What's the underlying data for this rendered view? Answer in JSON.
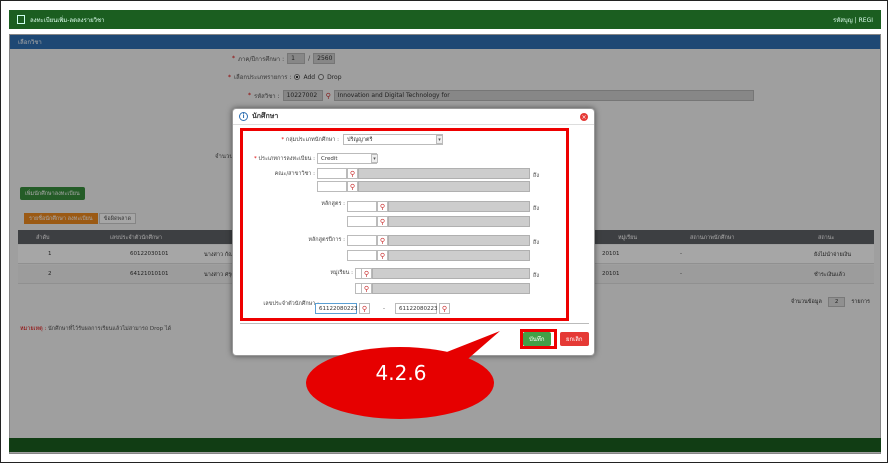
{
  "topbar": {
    "title": "ลงทะเบียนเพิ่ม-ลดลงรายวิชา",
    "user": "รหัสบุญ | REGI"
  },
  "section": {
    "title": "เลือกวิชา"
  },
  "form": {
    "term_label": "ภาค/ปีการศึกษา :",
    "term_value": "1",
    "year_value": "2560",
    "type_label": "เลือกประเภทรายการ :",
    "add_label": "Add",
    "drop_label": "Drop",
    "course_label": "รหัสวิชา :",
    "course_code": "10227002",
    "course_name": "Innovation and Digital Technology for",
    "other_label": "จำนวน"
  },
  "list_button": "เพิ่มนักศึกษาลงทะเบียน",
  "tabs": [
    "รายชื่อนักศึกษา ลงทะเบียน",
    "ข้อผิดพลาด"
  ],
  "table": {
    "headers": [
      "ลำดับ",
      "เลขประจำตัวนักศึกษา",
      "หมู่เรียน",
      "สถานภาพนักศึกษา",
      "สถานะ"
    ],
    "rows": [
      {
        "no": "1",
        "id": "60122030101",
        "name": "นางสาว กัณฑ์",
        "group": "20101",
        "status": "-",
        "state": "ยังไม่นำจ่ายเงิน"
      },
      {
        "no": "2",
        "id": "64121010101",
        "name": "นางสาว ศรุดา",
        "group": "20101",
        "status": "-",
        "state": "ชำระเงินแล้ว"
      }
    ]
  },
  "pager": {
    "label": "จำนวนข้อมูล",
    "count": "2",
    "unit": "รายการ"
  },
  "note": {
    "prefix": "หมายเหตุ :",
    "text": "นักศึกษาที่ไว้รับผลการเรียนแล้วไม่สามารถ Drop ได้"
  },
  "modal": {
    "title": "นักศึกษา",
    "student_type_label": "กลุ่มประเภทนักศึกษา :",
    "student_type_value": "ปริญญาตรี",
    "reg_type_label": "ประเภทการลงทะเบียน :",
    "reg_type_value": "Credit",
    "faculty_label": "คณะ/สาขาวิชา :",
    "curriculum_label": "หลักสูตร :",
    "curriculum_year_label": "หลักสูตรปีการ :",
    "group_label": "หมู่เรียน :",
    "student_id_label": "เลขประจำตัวนักศึกษา :",
    "to_label": "ถึง",
    "id_from": "61122080223",
    "id_to": "61122080223",
    "save": "บันทึก",
    "cancel": "ยกเลิก"
  },
  "callout": {
    "label": "4.2.6"
  }
}
